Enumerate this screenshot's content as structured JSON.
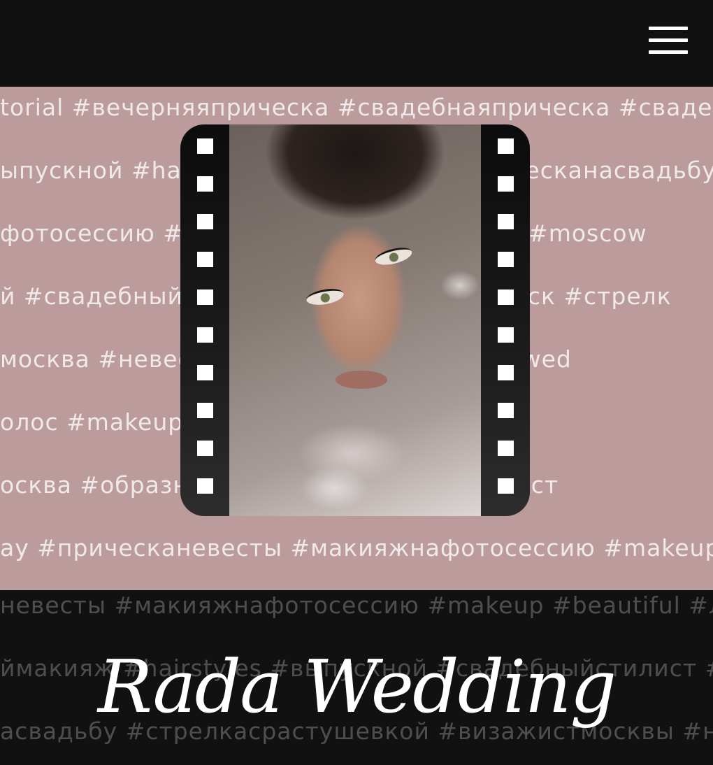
{
  "header": {
    "menu_icon": "hamburger-menu-icon"
  },
  "hashtag_rows_light": [
    "torial #вечерняяприческа #свадебнаяприческа #свадебн",
    "ыпускной #hairstyles #выпускной #прическанасвадьбу #стре",
    "фотосессию #makeup #визажистмосква #moscow",
    "й #свадебныйстилист #свадебныеприческ #стрелк",
    "москва #невестамосква #макияжглаз #wed",
    "олос #makeuptutorial #свадебнаяприс",
    "осква #образнасвадьбу #локоны #стилист",
    "ay #прическаневесты #макияжнафотосессию #makeup #l"
  ],
  "hashtag_rows_dark": [
    "невесты #макияжнафотосессию #makeup #beautiful #лок",
    "ймакияж #hairstyles #выпускной #свадебныйстилист #сва",
    "асвадьбу #стрелкасрастушевкой #визажистмосквы #невес"
  ],
  "hero": {
    "photo_alt": "bride-makeup-portrait"
  },
  "brand": {
    "title": "Rada Wedding"
  },
  "colors": {
    "band": "#bc9b9d",
    "background": "#111111"
  }
}
